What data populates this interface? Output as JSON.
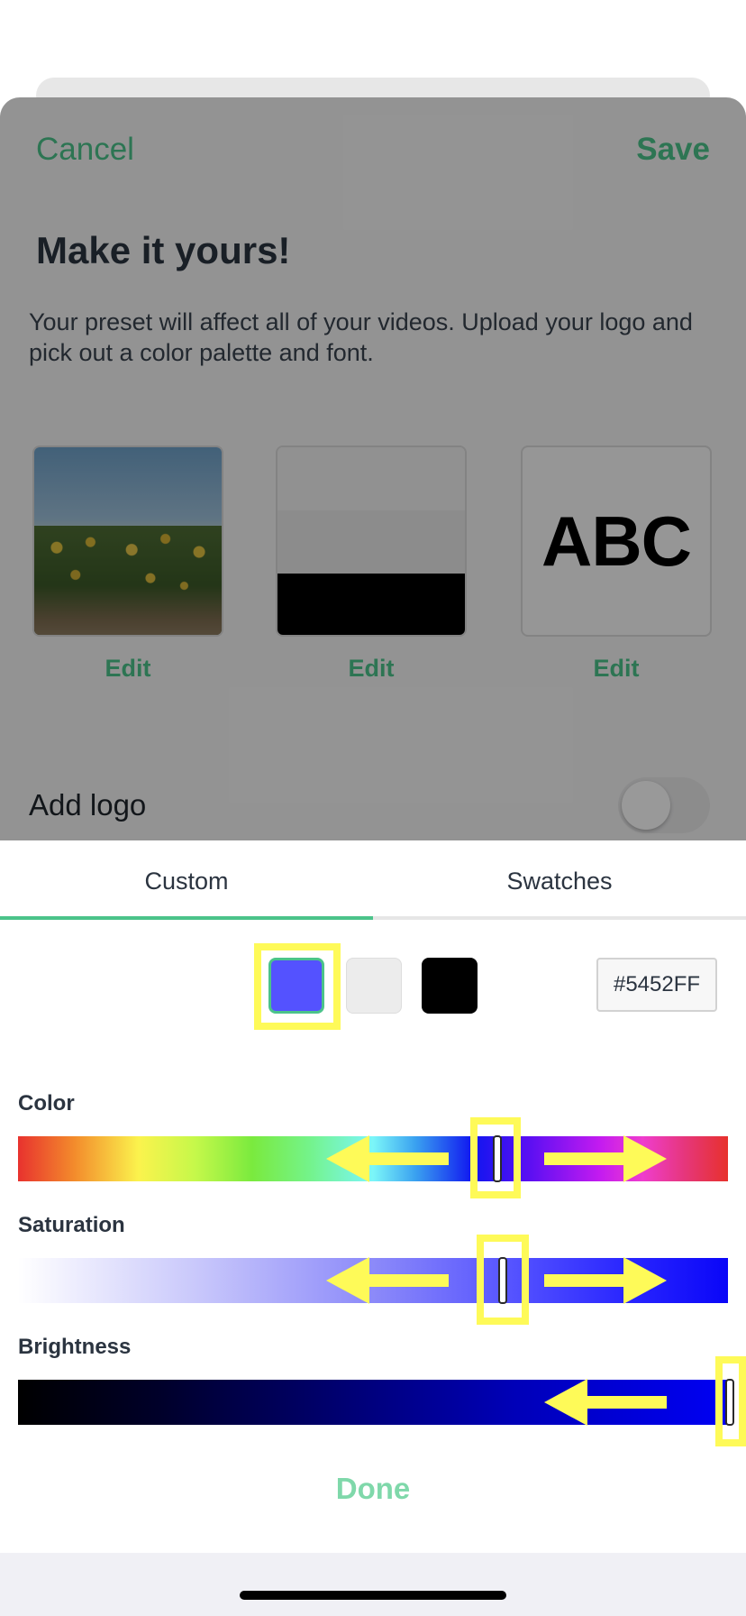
{
  "sheet": {
    "cancel_label": "Cancel",
    "save_label": "Save",
    "title": "Make it yours!",
    "description": "Your preset will affect all of your videos. Upload your logo and pick out a color palette and font.",
    "tiles": [
      {
        "kind": "photo",
        "edit_label": "Edit"
      },
      {
        "kind": "palette",
        "colors": [
          "#f2f2f2",
          "#e9e9e9",
          "#000000"
        ],
        "edit_label": "Edit"
      },
      {
        "kind": "font",
        "sample_text": "ABC",
        "edit_label": "Edit"
      }
    ],
    "add_logo": {
      "label": "Add logo",
      "enabled": false
    }
  },
  "picker": {
    "tabs": [
      {
        "label": "Custom",
        "active": true
      },
      {
        "label": "Swatches",
        "active": false
      }
    ],
    "swatches": [
      {
        "color": "#5452FF",
        "selected": true
      },
      {
        "color": "#ECECEC",
        "selected": false
      },
      {
        "color": "#000000",
        "selected": false
      }
    ],
    "hex_value": "#5452FF",
    "sliders": [
      {
        "label": "Color"
      },
      {
        "label": "Saturation"
      },
      {
        "label": "Brightness"
      }
    ],
    "done_label": "Done"
  },
  "colors": {
    "accent": "#4BC38A",
    "done": "#7FD8AA",
    "highlight": "#FEFA58",
    "selected_color": "#5452FF"
  }
}
